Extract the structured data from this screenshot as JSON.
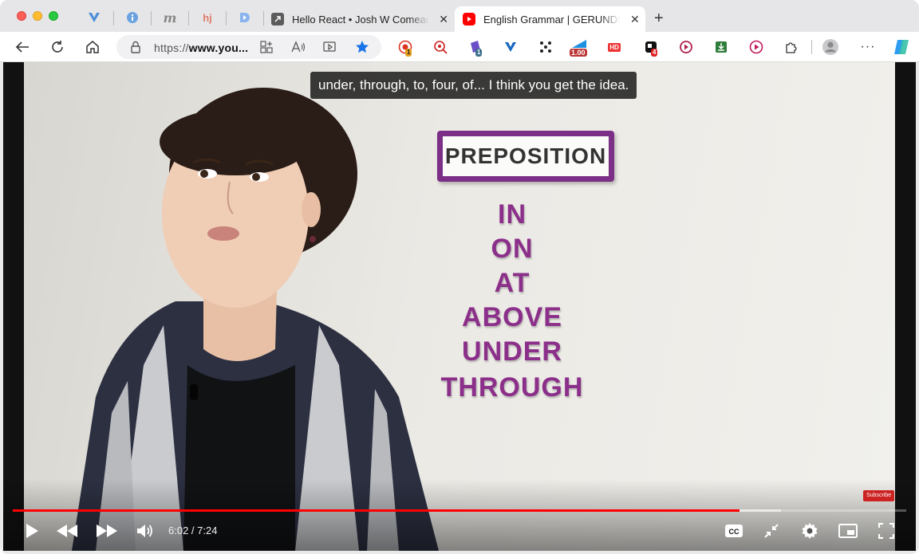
{
  "browser": {
    "url_scheme": "https://",
    "url_host": "www.you...",
    "tabs": [
      {
        "title": "Hello React • Josh W Comeau",
        "active": false
      },
      {
        "title": "English Grammar | GERUNDS in English",
        "active": true
      }
    ],
    "extension_badges": {
      "ext1": "1",
      "ext2": "1",
      "speed": "1.00",
      "hd": "HD",
      "ext4": "4"
    }
  },
  "video": {
    "caption": "under, through, to, four, of... I think you get the idea.",
    "board_title": "PREPOSITION",
    "prepositions": [
      "IN",
      "ON",
      "AT",
      "ABOVE",
      "UNDER",
      "THROUGH"
    ],
    "subscribe_label": "Subscribe",
    "time_display": "6:02 / 7:24",
    "progress_fraction": 0.813,
    "buffer_fraction": 0.86
  },
  "colors": {
    "progress": "#ff0000",
    "accent_purple": "#7b2f86",
    "youtube_red": "#ff0000"
  }
}
